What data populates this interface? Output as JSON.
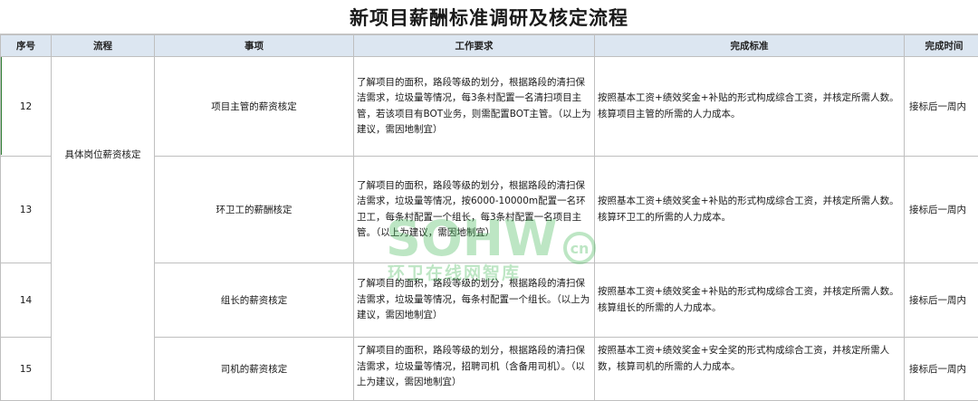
{
  "title": "新项目薪酬标准调研及核定流程",
  "headers": {
    "seq": "序号",
    "process": "流程",
    "item": "事项",
    "requirements": "工作要求",
    "standard": "完成标准",
    "time": "完成时间"
  },
  "process_group": "具体岗位薪资核定",
  "rows": [
    {
      "seq": "12",
      "item": "项目主管的薪资核定",
      "requirements": "了解项目的面积，路段等级的划分，根据路段的清扫保洁需求，垃圾量等情况，每3条村配置一名清扫项目主管，若该项目有BOT业务，则需配置BOT主管。（以上为建议，需因地制宜）",
      "standard": "按照基本工资+绩效奖金+补贴的形式构成综合工资，并核定所需人数。核算项目主管的所需的人力成本。",
      "time": "接标后一周内"
    },
    {
      "seq": "13",
      "item": "环卫工的薪酬核定",
      "requirements": "了解项目的面积，路段等级的划分，根据路段的清扫保洁需求，垃圾量等情况，按6000-10000m配置一名环卫工，每条村配置一个组长，每3条村配置一名项目主管。（以上为建议，需因地制宜）",
      "standard": "按照基本工资+绩效奖金+补贴的形式构成综合工资，并核定所需人数。核算环卫工的所需的人力成本。",
      "time": "接标后一周内"
    },
    {
      "seq": "14",
      "item": "组长的薪资核定",
      "requirements": "了解项目的面积，路段等级的划分，根据路段的清扫保洁需求，垃圾量等情况，每条村配置一个组长。（以上为建议，需因地制宜）",
      "standard": "按照基本工资+绩效奖金+补贴的形式构成综合工资，并核定所需人数。核算组长的所需的人力成本。",
      "time": "接标后一周内"
    },
    {
      "seq": "15",
      "item": "司机的薪资核定",
      "requirements": "了解项目的面积，路段等级的划分，根据路段的清扫保洁需求，垃圾量等情况，招聘司机（含备用司机）。（以上为建议，需因地制宜）",
      "standard": "按照基本工资+绩效奖金+安全奖的形式构成综合工资，并核定所需人数，核算司机的所需的人力成本。",
      "time": "接标后一周内"
    }
  ],
  "watermark": {
    "main": "SOHW",
    "sub": "环卫在线网智库",
    "badge": "cn",
    "color": "#35b24a"
  }
}
